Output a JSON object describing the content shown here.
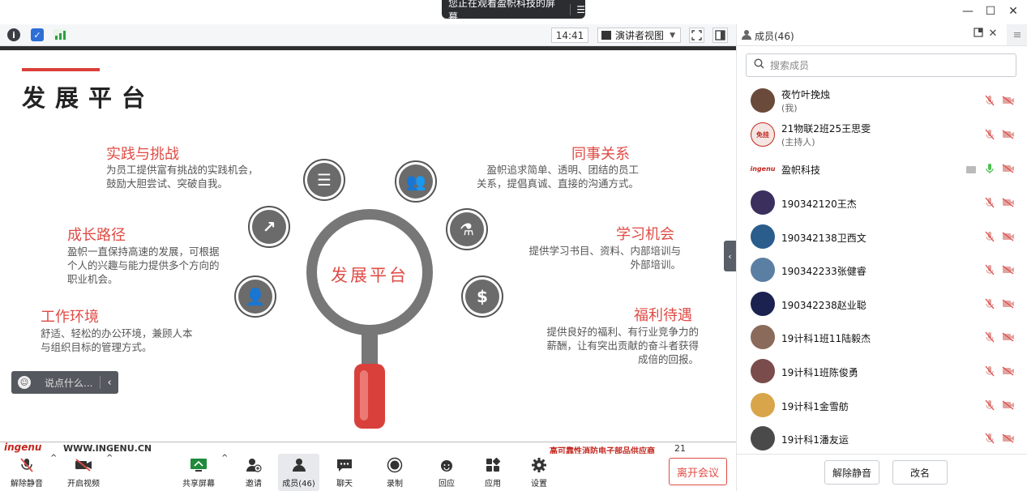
{
  "share_bar": {
    "text": "您正在观看盈帜科技的屏幕",
    "menu_icon": "list-icon"
  },
  "window_controls": {
    "minimize": "—",
    "maximize": "☐",
    "close": "✕"
  },
  "top_toolbar": {
    "info_icon": "i",
    "shield_icon": "✓",
    "clock": "14:41",
    "view_label": "演讲者视图",
    "view_caret": "▼"
  },
  "slide": {
    "title": "发展平台",
    "center_text": "发展平台",
    "sections": [
      {
        "title": "实践与挑战",
        "desc": [
          "为员工提供富有挑战的实践机会，",
          "鼓励大胆尝试、突破自我。"
        ]
      },
      {
        "title": "成长路径",
        "desc": [
          "盈帜一直保持高速的发展，可根据",
          "个人的兴趣与能力提供多个方向的",
          "职业机会。"
        ]
      },
      {
        "title": "工作环境",
        "desc": [
          "舒适、轻松的办公环境，兼顾人本",
          "与组织目标的管理方式。"
        ]
      },
      {
        "title": "同事关系",
        "desc": [
          "盈帜追求简单、透明、团结的员工",
          "关系，提倡真诚、直接的沟通方式。"
        ]
      },
      {
        "title": "学习机会",
        "desc": [
          "提供学习书目、资料、内部培训与",
          "外部培训。"
        ]
      },
      {
        "title": "福利待遇",
        "desc": [
          "提供良好的福利、有行业竞争力的",
          "薪酬，让有突出贡献的奋斗者获得",
          "成倍的回报。"
        ]
      }
    ],
    "icon_glyphs": {
      "document": "☰",
      "team": "👥",
      "growth": "↗",
      "lab": "⚗",
      "person": "👤",
      "dollar": "$"
    },
    "logo": "ingenu",
    "website": "WWW.INGENU.CN",
    "slogan": "高可靠性消防电子部品供应商",
    "page_number": "21"
  },
  "chat_input": {
    "placeholder": "说点什么...",
    "face": "☺",
    "collapse": "‹"
  },
  "side_toggle": "‹",
  "bottom_toolbar": {
    "unmute": "解除静音",
    "start_video": "开启视频",
    "share_screen": "共享屏幕",
    "invite": "邀请",
    "members": "成员(46)",
    "chat": "聊天",
    "record": "录制",
    "reactions": "回应",
    "apps": "应用",
    "settings": "设置",
    "leave": "离开会议",
    "caret": "^"
  },
  "panel": {
    "title": "成员(46)",
    "search_placeholder": "搜索成员",
    "members": [
      {
        "name": "夜竹叶挽烛",
        "sub": "(我)",
        "mic_on": false,
        "sharing": false,
        "avatar": "#6a4a3a"
      },
      {
        "name": "21物联2班25王思雯",
        "sub": "(主持人)",
        "mic_on": false,
        "sharing": false,
        "avatar": "#f4e6e3",
        "avatar_text": "免挂"
      },
      {
        "name": "盈帜科技",
        "sub": "",
        "mic_on": true,
        "sharing": true,
        "avatar": "#c3271f",
        "avatar_text": "ingenu"
      },
      {
        "name": "190342120王杰",
        "sub": "",
        "mic_on": false,
        "sharing": false,
        "avatar": "#3b2f5e"
      },
      {
        "name": "190342138卫西文",
        "sub": "",
        "mic_on": false,
        "sharing": false,
        "avatar": "#2a5d8c"
      },
      {
        "name": "190342233张健睿",
        "sub": "",
        "mic_on": false,
        "sharing": false,
        "avatar": "#5b7fa3"
      },
      {
        "name": "190342238赵业聪",
        "sub": "",
        "mic_on": false,
        "sharing": false,
        "avatar": "#1b2250"
      },
      {
        "name": "19计科1班11陆毅杰",
        "sub": "",
        "mic_on": false,
        "sharing": false,
        "avatar": "#8a6a5a"
      },
      {
        "name": "19计科1班陈俊勇",
        "sub": "",
        "mic_on": false,
        "sharing": false,
        "avatar": "#7a4c4c"
      },
      {
        "name": "19计科1金雪舫",
        "sub": "",
        "mic_on": false,
        "sharing": false,
        "avatar": "#d9a54a"
      },
      {
        "name": "19计科1潘友运",
        "sub": "",
        "mic_on": false,
        "sharing": false,
        "avatar": "#4a4a4a"
      }
    ],
    "mic_glyph": "⌀",
    "cam_glyph": "▭",
    "unmute_all": "解除静音",
    "rename": "改名"
  }
}
